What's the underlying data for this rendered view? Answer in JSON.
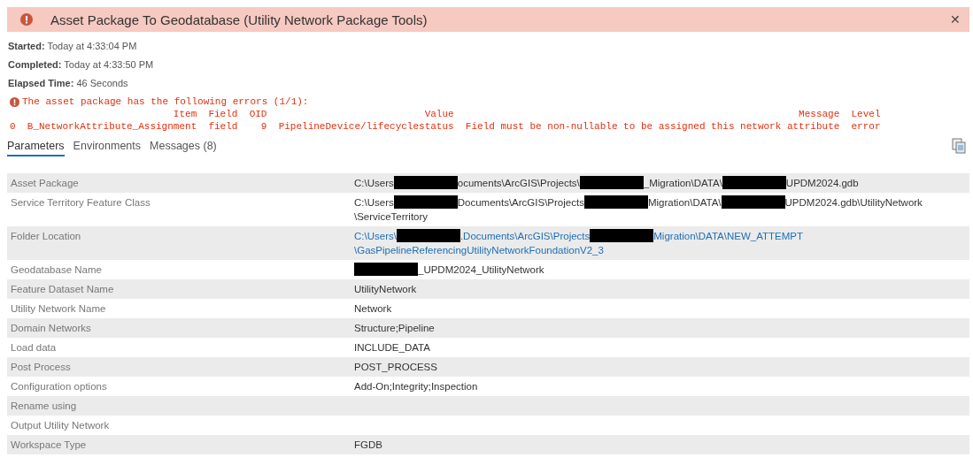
{
  "header": {
    "title": "Asset Package To Geodatabase (Utility Network Package Tools)",
    "close": "✕"
  },
  "info": [
    {
      "label": "Started:",
      "value": "Today at 4:33:04 PM"
    },
    {
      "label": "Completed:",
      "value": "Today at 4:33:50 PM"
    },
    {
      "label": "Elapsed Time:",
      "value": "46 Seconds"
    }
  ],
  "error": {
    "message": "The asset package has the following errors (1/1):",
    "columns": [
      "",
      "Item",
      "Field",
      "OID",
      "Value",
      "Message",
      "Level"
    ],
    "rows": [
      [
        "0",
        "B_NetworkAttribute_Assignment",
        "field",
        "9",
        "PipelineDevice/lifecyclestatus",
        "Field must be non-nullable to be assigned this network attribute",
        "error"
      ]
    ]
  },
  "tabs": [
    {
      "label": "Parameters",
      "selected": true
    },
    {
      "label": "Environments",
      "selected": false
    },
    {
      "label": "Messages (8)",
      "selected": false
    }
  ],
  "parameters": [
    {
      "label": "Asset Package",
      "kind": "text",
      "lines": [
        [
          {
            "kind": "text",
            "text": "C:\\Users"
          },
          {
            "kind": "redacted"
          },
          {
            "kind": "text",
            "text": "ocuments\\ArcGIS\\Projects\\"
          },
          {
            "kind": "redacted"
          },
          {
            "kind": "text",
            "text": "_Migration\\DATA\\"
          },
          {
            "kind": "redacted"
          },
          {
            "kind": "text",
            "text": "UPDM2024.gdb"
          }
        ]
      ]
    },
    {
      "label": "Service Territory Feature Class",
      "kind": "text",
      "lines": [
        [
          {
            "kind": "text",
            "text": "C:\\Users"
          },
          {
            "kind": "redacted"
          },
          {
            "kind": "text",
            "text": "Documents\\ArcGIS\\Projects"
          },
          {
            "kind": "redacted"
          },
          {
            "kind": "text",
            "text": "Migration\\DATA\\"
          },
          {
            "kind": "redacted"
          },
          {
            "kind": "text",
            "text": "UPDM2024.gdb\\UtilityNetwork"
          }
        ],
        [
          {
            "kind": "text",
            "text": "\\ServiceTerritory"
          }
        ]
      ]
    },
    {
      "label": "Folder Location",
      "kind": "link",
      "lines": [
        [
          {
            "kind": "text",
            "text": "C:\\Users\\"
          },
          {
            "kind": "redacted"
          },
          {
            "kind": "text",
            "text": ".Documents\\ArcGIS\\Projects"
          },
          {
            "kind": "redacted"
          },
          {
            "kind": "text",
            "text": "Migration\\DATA\\NEW_ATTEMPT"
          }
        ],
        [
          {
            "kind": "text",
            "text": "\\GasPipelineReferencingUtilityNetworkFoundationV2_3"
          }
        ]
      ]
    },
    {
      "label": "Geodatabase Name",
      "kind": "text",
      "lines": [
        [
          {
            "kind": "redacted"
          },
          {
            "kind": "text",
            "text": "_UPDM2024_UtilityNetwork"
          }
        ]
      ]
    },
    {
      "label": "Feature Dataset Name",
      "kind": "text",
      "lines": [
        [
          {
            "kind": "text",
            "text": "UtilityNetwork"
          }
        ]
      ]
    },
    {
      "label": "Utility Network Name",
      "kind": "text",
      "lines": [
        [
          {
            "kind": "text",
            "text": "Network"
          }
        ]
      ]
    },
    {
      "label": "Domain Networks",
      "kind": "text",
      "lines": [
        [
          {
            "kind": "text",
            "text": "Structure;Pipeline"
          }
        ]
      ]
    },
    {
      "label": "Load data",
      "kind": "text",
      "lines": [
        [
          {
            "kind": "text",
            "text": "INCLUDE_DATA"
          }
        ]
      ]
    },
    {
      "label": "Post Process",
      "kind": "text",
      "lines": [
        [
          {
            "kind": "text",
            "text": "POST_PROCESS"
          }
        ]
      ]
    },
    {
      "label": "Configuration options",
      "kind": "text",
      "lines": [
        [
          {
            "kind": "text",
            "text": "Add-On;Integrity;Inspection"
          }
        ]
      ]
    },
    {
      "label": "Rename using"
    },
    {
      "label": "Output Utility Network"
    },
    {
      "label": "Workspace Type",
      "kind": "text",
      "lines": [
        [
          {
            "kind": "text",
            "text": "FGDB"
          }
        ]
      ]
    }
  ]
}
